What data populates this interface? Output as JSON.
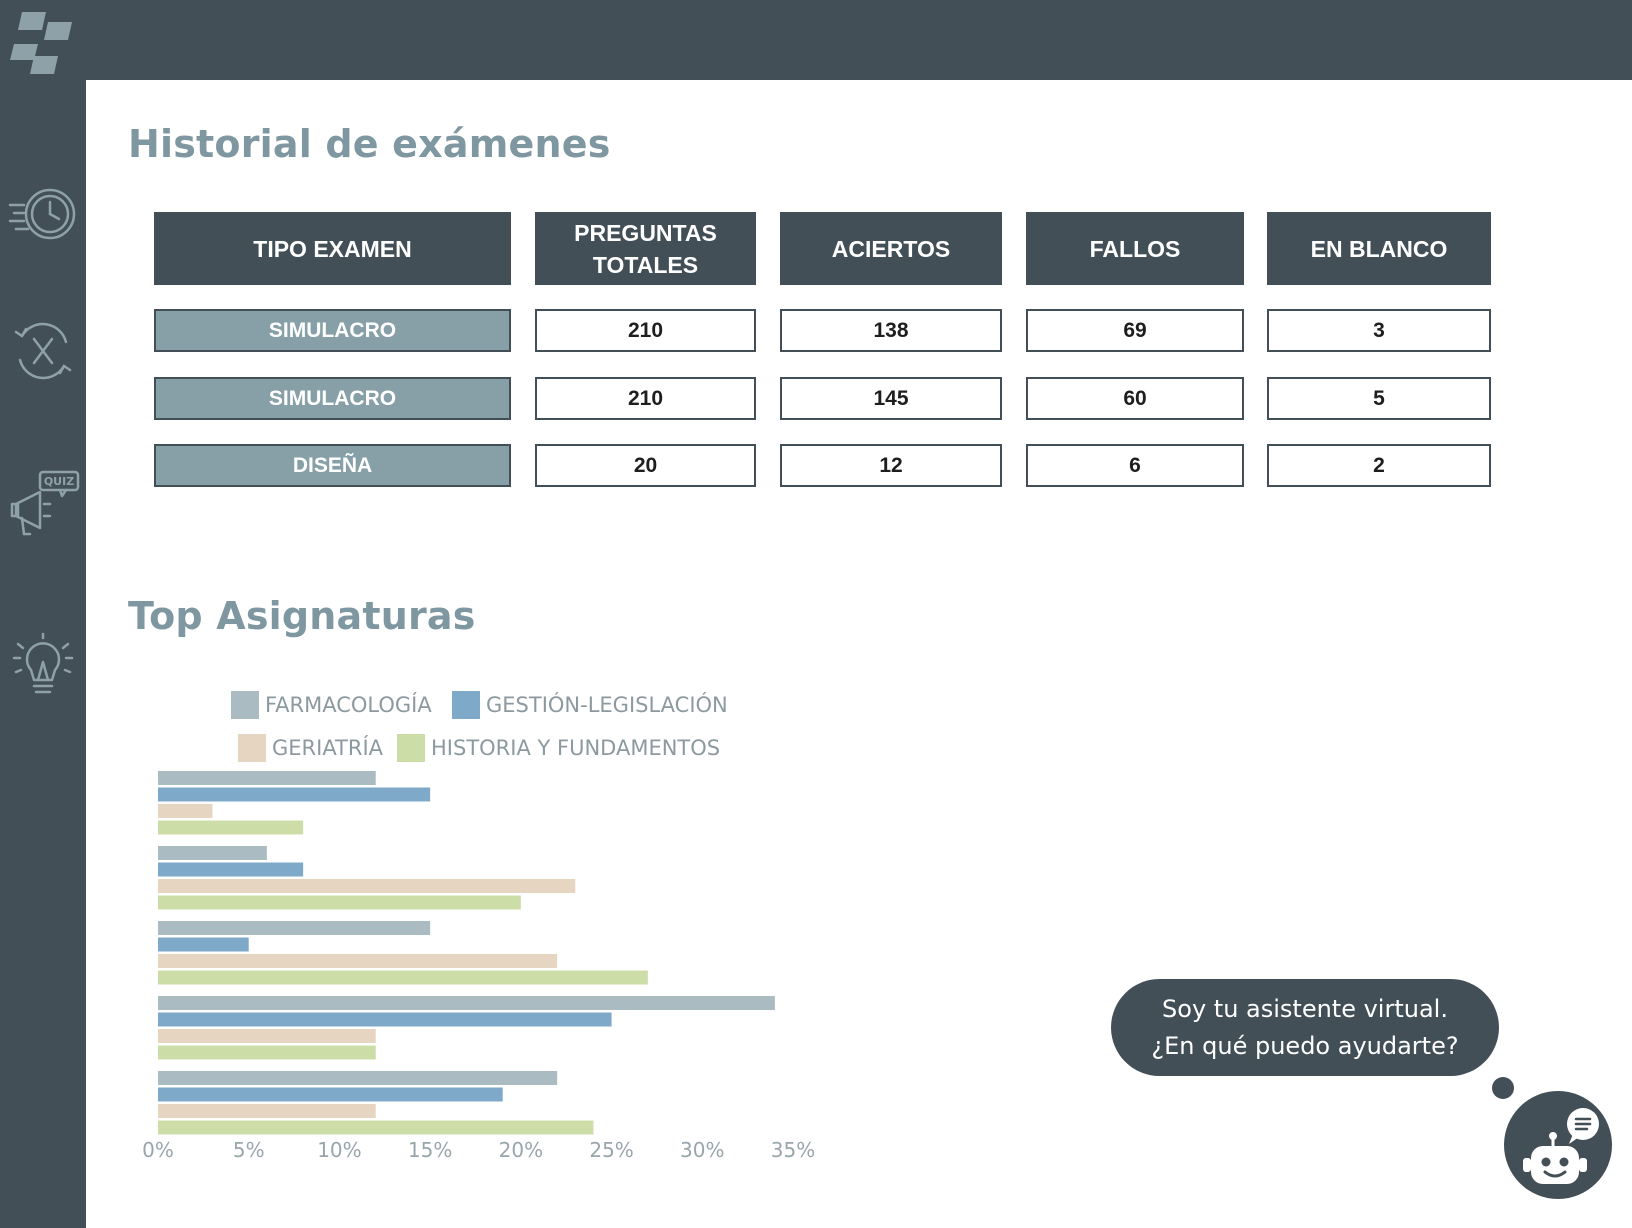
{
  "colors": {
    "dark": "#434f56",
    "accent_title": "#7e97a1",
    "type_cell": "#87a0a8",
    "farmacologia": "#aabbc2",
    "gestion": "#7fa9c8",
    "geriatria": "#e5d5c1",
    "historia": "#cddda8"
  },
  "sidebar": {
    "logo_icon": "brand-logo-icon",
    "items": [
      {
        "icon": "clock-speed-icon"
      },
      {
        "icon": "failed-retry-icon"
      },
      {
        "icon": "quiz-megaphone-icon",
        "badge": "QUIZ"
      },
      {
        "icon": "lightbulb-idea-icon"
      }
    ]
  },
  "history": {
    "title": "Historial de exámenes",
    "headers": {
      "tipo": "TIPO EXAMEN",
      "preguntas_l1": "PREGUNTAS",
      "preguntas_l2": "TOTALES",
      "aciertos": "ACIERTOS",
      "fallos": "FALLOS",
      "blanco": "EN BLANCO"
    },
    "rows": [
      {
        "tipo": "SIMULACRO",
        "preguntas": "210",
        "aciertos": "138",
        "fallos": "69",
        "blanco": "3"
      },
      {
        "tipo": "SIMULACRO",
        "preguntas": "210",
        "aciertos": "145",
        "fallos": "60",
        "blanco": "5"
      },
      {
        "tipo": "DISEÑA",
        "preguntas": "20",
        "aciertos": "12",
        "fallos": "6",
        "blanco": "2"
      }
    ]
  },
  "top": {
    "title": "Top Asignaturas"
  },
  "chart_data": {
    "type": "bar",
    "orientation": "horizontal",
    "categories": [
      "",
      "",
      "",
      "",
      ""
    ],
    "series": [
      {
        "name": "FARMACOLOGÍA",
        "color": "#aabbc2",
        "values": [
          12,
          6,
          15,
          34,
          22
        ]
      },
      {
        "name": "GESTIÓN-LEGISLACIÓN",
        "color": "#7fa9c8",
        "values": [
          15,
          8,
          5,
          25,
          19
        ]
      },
      {
        "name": "GERIATRÍA",
        "color": "#e5d5c1",
        "values": [
          3,
          23,
          22,
          12,
          12
        ]
      },
      {
        "name": "HISTORIA Y FUNDAMENTOS",
        "color": "#cddda8",
        "values": [
          8,
          20,
          27,
          12,
          24
        ]
      }
    ],
    "xticks": [
      "0%",
      "5%",
      "10%",
      "15%",
      "20%",
      "25%",
      "30%",
      "35%"
    ],
    "xlim": [
      0,
      35
    ],
    "legend_position": "top",
    "grid": false
  },
  "assistant": {
    "line1": "Soy tu asistente virtual.",
    "line2": "¿En qué puedo ayudarte?"
  }
}
